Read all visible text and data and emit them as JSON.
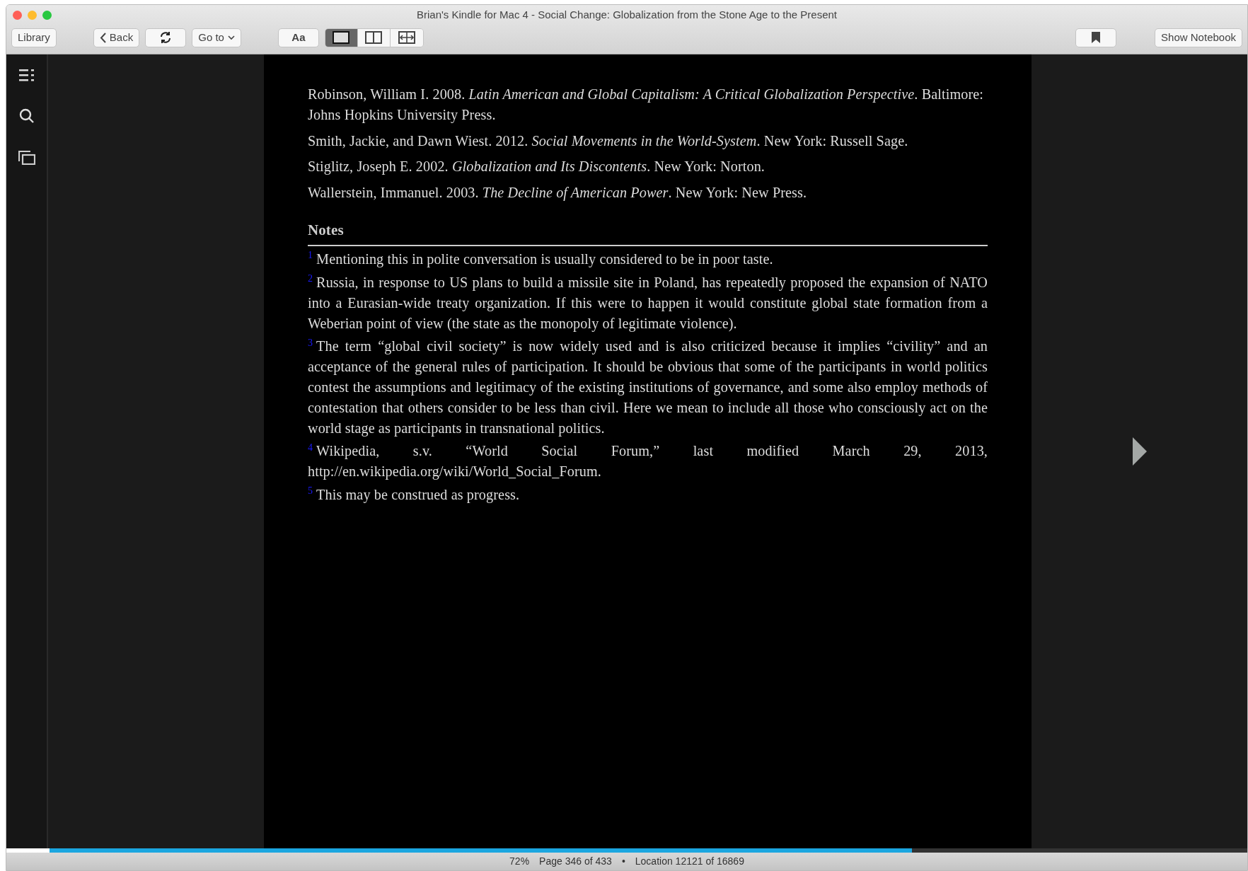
{
  "window": {
    "title": "Brian's Kindle for Mac 4 - Social Change: Globalization from the Stone Age to the Present"
  },
  "toolbar": {
    "library": "Library",
    "back": "Back",
    "goto": "Go to",
    "font": "Aa",
    "view_modes": [
      {
        "kind": "single",
        "selected": true
      },
      {
        "kind": "double",
        "selected": false
      },
      {
        "kind": "fit",
        "selected": false
      }
    ],
    "notebook": "Show Notebook"
  },
  "references": [
    "Robinson, William I. 2008. *Latin American and Global Capitalism: A Critical Globalization Perspective*. Baltimore: Johns Hopkins University Press.",
    "Smith, Jackie, and Dawn Wiest. 2012. *Social Movements in the World-System*. New York: Russell Sage.",
    "Stiglitz, Joseph E. 2002. *Globalization and Its Discontents*. New York: Norton.",
    "Wallerstein, Immanuel. 2003. *The Decline of American Power*. New York: New Press."
  ],
  "notes_heading": "Notes",
  "notes": [
    {
      "number": "1",
      "text": "Mentioning this in polite conversation is usually considered to be in poor taste."
    },
    {
      "number": "2",
      "text": "Russia, in response to US plans to build a missile site in Poland, has repeatedly proposed the expansion of NATO into a Eurasian-wide treaty organization. If this were to happen it would constitute global state formation from a Weberian point of view (the state as the monopoly of legitimate violence)."
    },
    {
      "number": "3",
      "text": "The term “global civil society” is now widely used and is also criticized because it implies “civility” and an acceptance of the general rules of participation. It should be obvious that some of the participants in world politics contest the assumptions and legitimacy of the existing institutions of governance, and some also employ methods of contestation that others consider to be less than civil. Here we mean to include all those who consciously act on the world stage as participants in transnational politics."
    },
    {
      "number": "4",
      "text": "Wikipedia, s.v. “World Social Forum,” last modified March 29, 2013, http://en.wikipedia.org/wiki/World_Social_Forum."
    },
    {
      "number": "5",
      "text": "This may be construed as progress."
    }
  ],
  "progress": {
    "level": 0.72
  },
  "status_bar": {
    "percent": "72%",
    "page": "Page 346 of 433",
    "separator": "•",
    "location": "Location 12121 of 16869"
  }
}
